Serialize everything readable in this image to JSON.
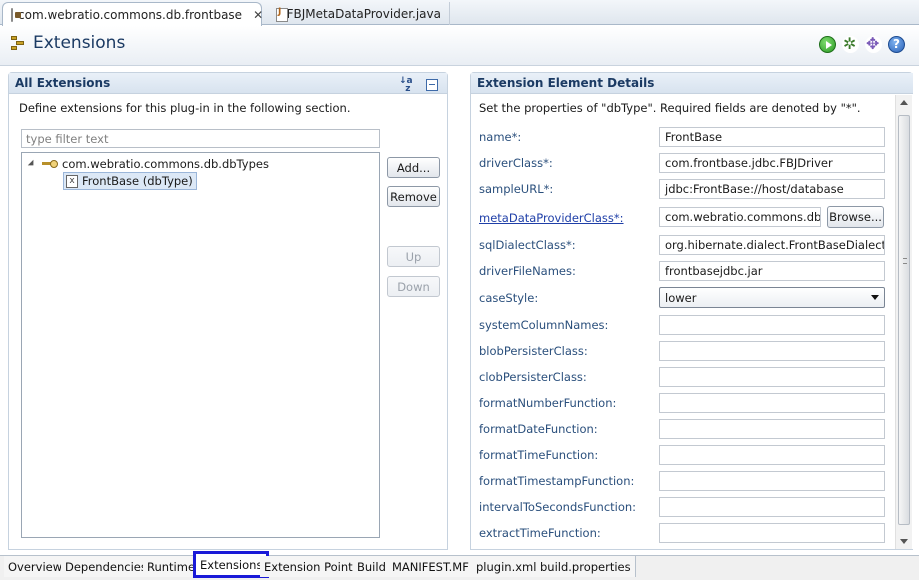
{
  "editor_tabs": [
    {
      "label": "com.webratio.commons.db.frontbase",
      "active": true,
      "close": "✕"
    },
    {
      "label": "FBJMetaDataProvider.java",
      "active": false
    }
  ],
  "header": {
    "title": "Extensions"
  },
  "all_extensions": {
    "title": "All Extensions",
    "description": "Define extensions for this plug-in in the following section.",
    "filter_placeholder": "type filter text",
    "tree": {
      "root": "com.webratio.commons.db.dbTypes",
      "child": "FrontBase (dbType)"
    },
    "buttons": {
      "add": "Add...",
      "remove": "Remove",
      "up": "Up",
      "down": "Down"
    }
  },
  "details": {
    "title": "Extension Element Details",
    "description": "Set the properties of \"dbType\". Required fields are denoted by \"*\".",
    "browse_label": "Browse...",
    "fields": [
      {
        "label": "name*:",
        "value": "FrontBase"
      },
      {
        "label": "driverClass*:",
        "value": "com.frontbase.jdbc.FBJDriver"
      },
      {
        "label": "sampleURL*:",
        "value": "jdbc:FrontBase://host/database"
      },
      {
        "label": "metaDataProviderClass*:",
        "value": "com.webratio.commons.db.f"
      },
      {
        "label": "sqlDialectClass*:",
        "value": "org.hibernate.dialect.FrontBaseDialect"
      },
      {
        "label": "driverFileNames:",
        "value": "frontbasejdbc.jar"
      },
      {
        "label": "caseStyle:",
        "value": "lower"
      },
      {
        "label": "systemColumnNames:",
        "value": ""
      },
      {
        "label": "blobPersisterClass:",
        "value": ""
      },
      {
        "label": "clobPersisterClass:",
        "value": ""
      },
      {
        "label": "formatNumberFunction:",
        "value": ""
      },
      {
        "label": "formatDateFunction:",
        "value": ""
      },
      {
        "label": "formatTimeFunction:",
        "value": ""
      },
      {
        "label": "formatTimestampFunction:",
        "value": ""
      },
      {
        "label": "intervalToSecondsFunction:",
        "value": ""
      },
      {
        "label": "extractTimeFunction:",
        "value": ""
      }
    ]
  },
  "page_tabs": [
    {
      "label": "Overview"
    },
    {
      "label": "Dependencies"
    },
    {
      "label": "Runtime"
    },
    {
      "label": "Extensions",
      "active": true
    },
    {
      "label": "Extension Points"
    },
    {
      "label": "Build"
    },
    {
      "label": "MANIFEST.MF"
    },
    {
      "label": "plugin.xml"
    },
    {
      "label": "build.properties"
    }
  ]
}
